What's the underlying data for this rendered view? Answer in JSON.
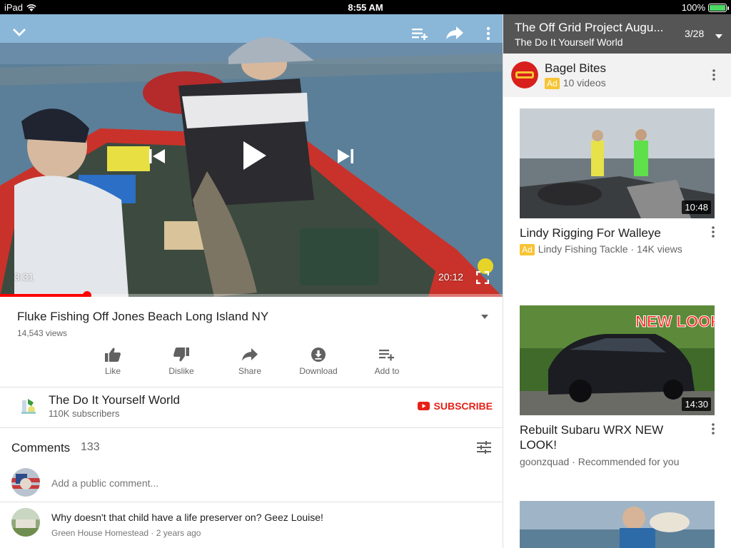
{
  "status_bar": {
    "device": "iPad",
    "time": "8:55 AM",
    "battery": "100%"
  },
  "player": {
    "current_time": "3:31",
    "duration": "20:12",
    "progress": 0.174
  },
  "video": {
    "title": "Fluke Fishing Off Jones Beach Long Island NY",
    "views": "14,543 views",
    "actions": {
      "like": "Like",
      "dislike": "Dislike",
      "share": "Share",
      "download": "Download",
      "add_to": "Add to"
    }
  },
  "channel": {
    "name": "The Do It Yourself World",
    "subscribers": "110K subscribers",
    "subscribe_label": "SUBSCRIBE"
  },
  "comments": {
    "title": "Comments",
    "count": "133",
    "placeholder": "Add a public comment...",
    "items": [
      {
        "text": "Why doesn't that child have a life preserver on?  Geez Louise!",
        "author": "Green House Homestead",
        "age": "2 years ago"
      }
    ]
  },
  "playlist": {
    "title": "The Off Grid Project Augu...",
    "channel": "The Do It Yourself World",
    "position": "3/28"
  },
  "ad": {
    "name": "Bagel Bites",
    "badge": "Ad",
    "videos": "10 videos"
  },
  "recommendations": [
    {
      "title": "Lindy Rigging For Walleye",
      "duration": "10:48",
      "ad_badge": "Ad",
      "meta": "Lindy Fishing Tackle · 14K views"
    },
    {
      "title": "Rebuilt Subaru WRX NEW LOOK!",
      "duration": "14:30",
      "overlay_text": "NEW LOOK",
      "meta": "goonzquad · Recommended for you"
    }
  ],
  "colors": {
    "accent_red": "#e62117",
    "progress_red": "#ff0000",
    "ad_yellow": "#f7c434",
    "playlist_header": "#555555"
  }
}
